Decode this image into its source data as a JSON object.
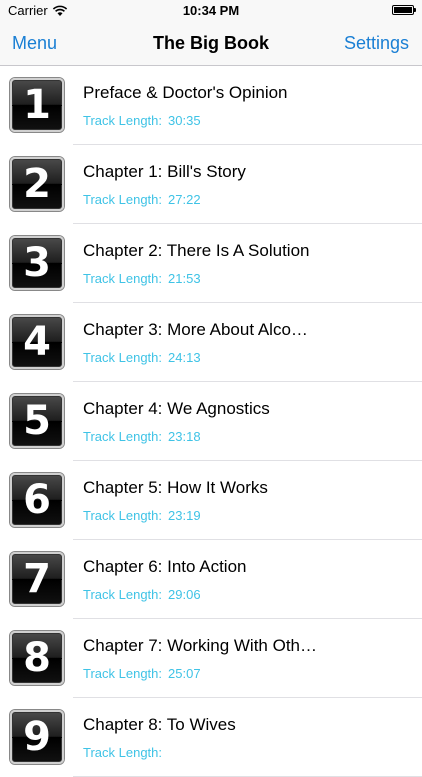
{
  "status": {
    "carrier": "Carrier",
    "time": "10:34 PM"
  },
  "nav": {
    "left_label": "Menu",
    "title": "The Big Book",
    "right_label": "Settings"
  },
  "track_label": "Track Length:",
  "chapters": [
    {
      "number": "1",
      "title": "Preface & Doctor's Opinion",
      "length": "30:35"
    },
    {
      "number": "2",
      "title": "Chapter 1: Bill's Story",
      "length": "27:22"
    },
    {
      "number": "3",
      "title": "Chapter 2: There Is A Solution",
      "length": "21:53"
    },
    {
      "number": "4",
      "title": "Chapter 3: More About Alco…",
      "length": "24:13"
    },
    {
      "number": "5",
      "title": "Chapter 4: We Agnostics",
      "length": "23:18"
    },
    {
      "number": "6",
      "title": "Chapter 5: How It Works",
      "length": "23:19"
    },
    {
      "number": "7",
      "title": "Chapter 6: Into Action",
      "length": "29:06"
    },
    {
      "number": "8",
      "title": "Chapter 7: Working With Oth…",
      "length": "25:07"
    },
    {
      "number": "9",
      "title": "Chapter 8: To Wives",
      "length": ""
    }
  ]
}
